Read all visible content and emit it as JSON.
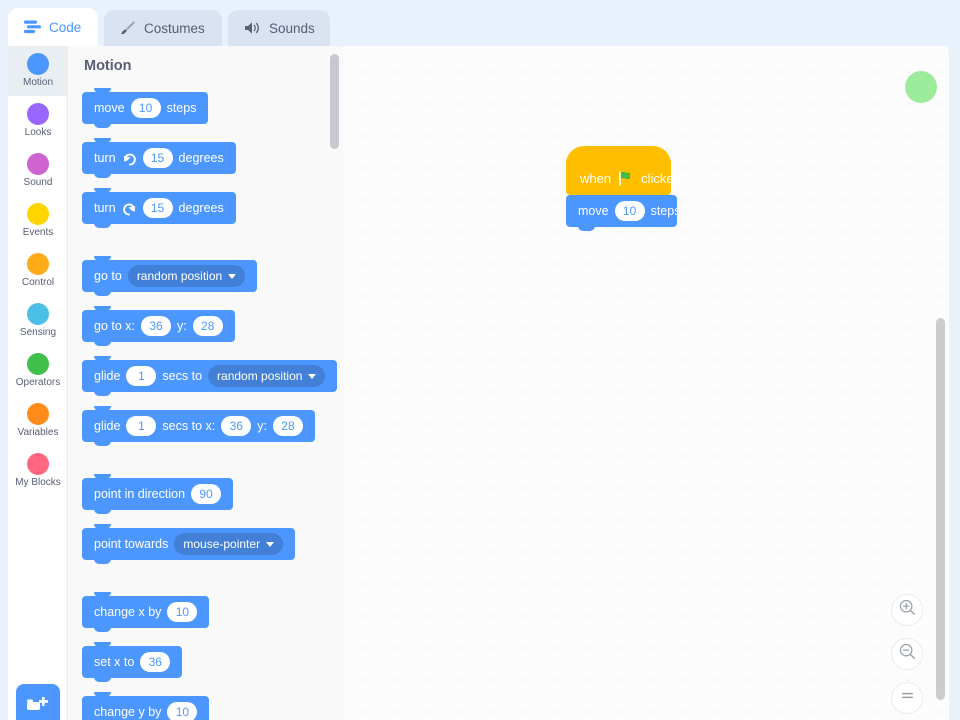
{
  "tabs": [
    {
      "id": "code",
      "label": "Code",
      "icon": "code-blocks-icon",
      "active": true
    },
    {
      "id": "costumes",
      "label": "Costumes",
      "icon": "paintbrush-icon",
      "active": false
    },
    {
      "id": "sounds",
      "label": "Sounds",
      "icon": "speaker-icon",
      "active": false
    }
  ],
  "categories": [
    {
      "id": "motion",
      "label": "Motion",
      "color": "#4c97ff",
      "selected": true
    },
    {
      "id": "looks",
      "label": "Looks",
      "color": "#9966ff",
      "selected": false
    },
    {
      "id": "sound",
      "label": "Sound",
      "color": "#cf63cf",
      "selected": false
    },
    {
      "id": "events",
      "label": "Events",
      "color": "#ffd500",
      "selected": false
    },
    {
      "id": "control",
      "label": "Control",
      "color": "#ffab19",
      "selected": false
    },
    {
      "id": "sensing",
      "label": "Sensing",
      "color": "#4cbfe6",
      "selected": false
    },
    {
      "id": "operators",
      "label": "Operators",
      "color": "#40bf4a",
      "selected": false
    },
    {
      "id": "variables",
      "label": "Variables",
      "color": "#ff8c1a",
      "selected": false
    },
    {
      "id": "myblocks",
      "label": "My Blocks",
      "color": "#ff6680",
      "selected": false
    }
  ],
  "extension_button": {
    "name": "add-extension-button",
    "icon": "blocks-plus-icon",
    "color": "#4c97ff"
  },
  "palette": {
    "title": "Motion",
    "blocks": [
      {
        "id": "move-steps",
        "parts": [
          {
            "t": "label",
            "v": "move"
          },
          {
            "t": "num",
            "v": "10"
          },
          {
            "t": "label",
            "v": "steps"
          }
        ]
      },
      {
        "id": "turn-right",
        "parts": [
          {
            "t": "label",
            "v": "turn"
          },
          {
            "t": "icon",
            "v": "turn-right-icon"
          },
          {
            "t": "num",
            "v": "15"
          },
          {
            "t": "label",
            "v": "degrees"
          }
        ]
      },
      {
        "id": "turn-left",
        "parts": [
          {
            "t": "label",
            "v": "turn"
          },
          {
            "t": "icon",
            "v": "turn-left-icon"
          },
          {
            "t": "num",
            "v": "15"
          },
          {
            "t": "label",
            "v": "degrees"
          }
        ]
      },
      {
        "id": "go-to",
        "parts": [
          {
            "t": "label",
            "v": "go to"
          },
          {
            "t": "drop",
            "v": "random position"
          }
        ]
      },
      {
        "id": "go-to-xy",
        "parts": [
          {
            "t": "label",
            "v": "go to x:"
          },
          {
            "t": "num",
            "v": "36"
          },
          {
            "t": "label",
            "v": "y:"
          },
          {
            "t": "num",
            "v": "28"
          }
        ]
      },
      {
        "id": "glide-secs-to",
        "parts": [
          {
            "t": "label",
            "v": "glide"
          },
          {
            "t": "num",
            "v": "1"
          },
          {
            "t": "label",
            "v": "secs to"
          },
          {
            "t": "drop",
            "v": "random position"
          }
        ]
      },
      {
        "id": "glide-secs-to-xy",
        "parts": [
          {
            "t": "label",
            "v": "glide"
          },
          {
            "t": "num",
            "v": "1"
          },
          {
            "t": "label",
            "v": "secs to x:"
          },
          {
            "t": "num",
            "v": "36"
          },
          {
            "t": "label",
            "v": "y:"
          },
          {
            "t": "num",
            "v": "28"
          }
        ]
      },
      {
        "id": "point-in-direction",
        "parts": [
          {
            "t": "label",
            "v": "point in direction"
          },
          {
            "t": "num",
            "v": "90"
          }
        ]
      },
      {
        "id": "point-towards",
        "parts": [
          {
            "t": "label",
            "v": "point towards"
          },
          {
            "t": "drop",
            "v": "mouse-pointer"
          }
        ]
      },
      {
        "id": "change-x-by",
        "parts": [
          {
            "t": "label",
            "v": "change x by"
          },
          {
            "t": "num",
            "v": "10"
          }
        ]
      },
      {
        "id": "set-x-to",
        "parts": [
          {
            "t": "label",
            "v": "set x to"
          },
          {
            "t": "num",
            "v": "36"
          }
        ]
      },
      {
        "id": "change-y-by",
        "parts": [
          {
            "t": "label",
            "v": "change y by"
          },
          {
            "t": "num",
            "v": "10"
          }
        ]
      }
    ]
  },
  "workspace": {
    "script": {
      "hat": {
        "id": "when-flag-clicked",
        "before": "when",
        "icon": "green-flag-icon",
        "after": "clicked"
      },
      "body": [
        {
          "id": "move-steps",
          "parts": [
            {
              "t": "label",
              "v": "move"
            },
            {
              "t": "num",
              "v": "10"
            },
            {
              "t": "label",
              "v": "steps"
            }
          ]
        }
      ]
    },
    "cursor_blob": {
      "name": "cursor-indicator",
      "color": "#89e889"
    },
    "zoom_controls": [
      {
        "id": "zoom-in",
        "icon": "zoom-in-icon",
        "label": "+"
      },
      {
        "id": "zoom-out",
        "icon": "zoom-out-icon",
        "label": "−"
      },
      {
        "id": "zoom-reset",
        "icon": "zoom-reset-icon",
        "label": "="
      }
    ]
  },
  "colors": {
    "motion": "#4c97ff",
    "events": "#ffbf00",
    "page_bg": "#e9f1fc",
    "palette_bg": "#f9f9f9",
    "workspace_bg": "#fcfcfc"
  }
}
